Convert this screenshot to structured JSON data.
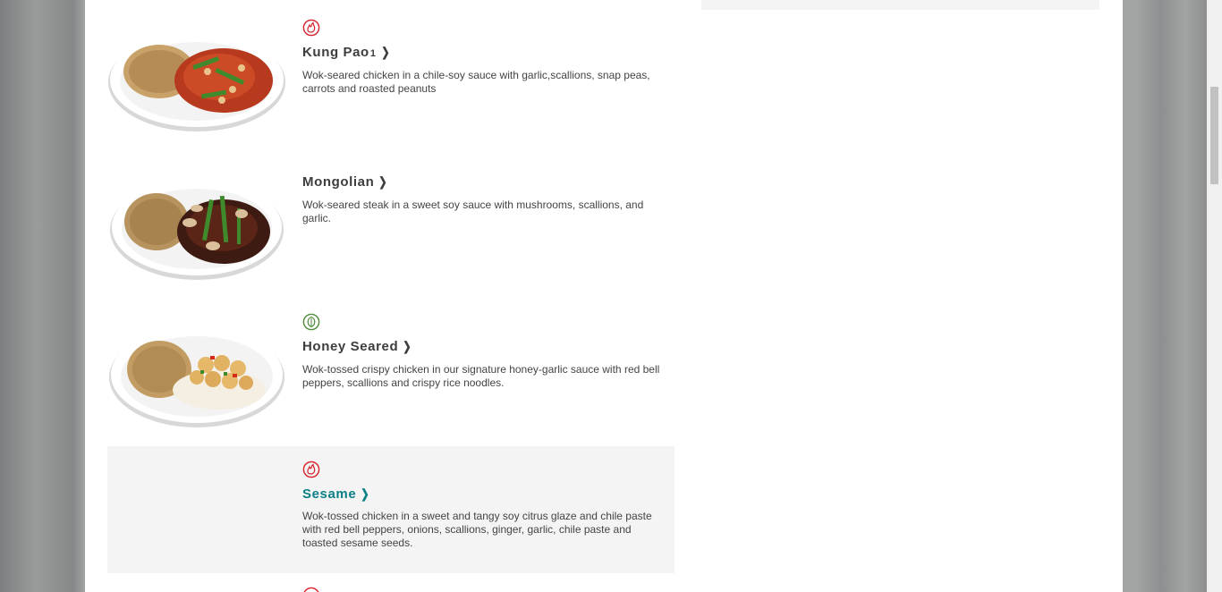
{
  "menu": {
    "items": [
      {
        "title": "Kung Pao",
        "superscript": "1",
        "description": "Wok-seared chicken in a chile-soy sauce with garlic,scallions, snap peas, carrots and roasted peanuts",
        "badge": "spicy-icon",
        "badge_color": "#d6202b",
        "dish": "kung-pao"
      },
      {
        "title": "Mongolian",
        "superscript": "",
        "description": "Wok-seared steak in a sweet soy sauce with mushrooms, scallions, and garlic.",
        "badge": "",
        "badge_color": "",
        "dish": "mongolian"
      },
      {
        "title": "Honey Seared",
        "superscript": "",
        "description": "Wok-tossed crispy chicken in our signature honey-garlic sauce with red bell peppers, scallions and crispy rice noodles.",
        "badge": "leaf-icon",
        "badge_color": "#4e8b3a",
        "dish": "honey-seared"
      },
      {
        "title": "Sesame",
        "superscript": "",
        "description": "Wok-tossed chicken in a sweet and tangy soy citrus glaze and chile paste with red bell peppers, onions, scallions, ginger, garlic, chile paste and toasted sesame seeds.",
        "badge": "spicy-icon",
        "badge_color": "#d6202b",
        "dish": "sesame"
      }
    ],
    "chevron": "❯"
  },
  "colors": {
    "title": "#3d3d3d",
    "title_hover": "#0a7f86",
    "highlight_bg": "#f4f4f4",
    "spicy": "#d6202b",
    "veg": "#4e8b3a"
  }
}
